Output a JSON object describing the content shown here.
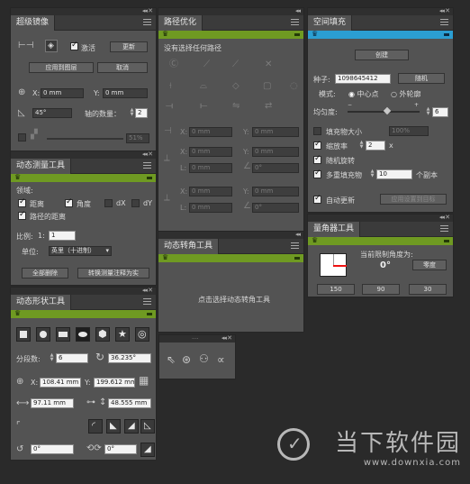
{
  "p1": {
    "title": "超级镜像",
    "check_label": "激活",
    "btn_update": "更新",
    "btn_apply_layer": "应用到图层",
    "btn_cancel": "取消",
    "x_label": "X:",
    "x_val": "0 mm",
    "y_label": "Y:",
    "y_val": "0 mm",
    "angle_val": "45°",
    "axis_label": "轴的数量：",
    "axis_val": "2",
    "opacity_val": "51%"
  },
  "p2": {
    "title": "路径优化",
    "empty_msg": "没有选择任何路径",
    "x_label": "X:",
    "y_label": "Y:",
    "l_label": "L:",
    "x1": "0 mm",
    "y1": "0 mm",
    "x2": "0 mm",
    "y2": "0 mm",
    "l2": "0 mm",
    "a2": "0°",
    "x3": "0 mm",
    "y3": "0 mm",
    "l3": "0 mm",
    "a3": "0°"
  },
  "p3": {
    "title": "空间填充",
    "btn_create": "创建",
    "seed_label": "种子:",
    "seed_val": "1098645412",
    "btn_random": "随机",
    "mode_label": "模式:",
    "radio_center": "中心点",
    "radio_outer": "外轮廓",
    "uniformity_label": "均匀度:",
    "uniformity_val": "6",
    "fill_size_label": "填充物大小",
    "fill_size_val": "100%",
    "scale_label": "缩放率",
    "scale_val": "2",
    "scale_unit": "x",
    "rand_rotate_label": "随机旋转",
    "multi_fill_label": "多重填充物",
    "multi_fill_val": "10",
    "copies_label": "个副本",
    "auto_update_label": "自动更新",
    "btn_apply_target": "应用设置到目标"
  },
  "p4": {
    "title": "动态测量工具",
    "region_label": "领域:",
    "distance_label": "距离",
    "angle_label": "角度",
    "dx_label": "dX",
    "dy_label": "dY",
    "path_distance_label": "路径的距离",
    "ratio_label": "比例:",
    "ratio_prefix": "1:",
    "ratio_val": "1",
    "unit_label": "单位:",
    "unit_val": "英里（十进制）",
    "btn_delete_all": "全部删除",
    "btn_convert": "转换测量注释为实"
  },
  "p5": {
    "title": "量角器工具",
    "current_angle_label": "当前限制角度为:",
    "current_angle_val": "0°",
    "btn_zero": "零度",
    "btn_150": "150",
    "btn_90": "90",
    "btn_30": "30"
  },
  "p6": {
    "title": "动态转角工具",
    "hint": "点击选择动态转角工具"
  },
  "p7": {
    "title": "动态形状工具",
    "segments_label": "分段数:",
    "segments_val": "6",
    "rotation_val": "36.235°",
    "x_label": "X:",
    "x_val": "108.41 mm",
    "y_label": "Y:",
    "y_val": "199.612 mm",
    "w_val": "97.11 mm",
    "h_val": "48.555 mm",
    "r1_val": "0°",
    "r2_val": "0°"
  },
  "watermark": {
    "brand": "当下软件园",
    "url": "www.downxia.com"
  }
}
